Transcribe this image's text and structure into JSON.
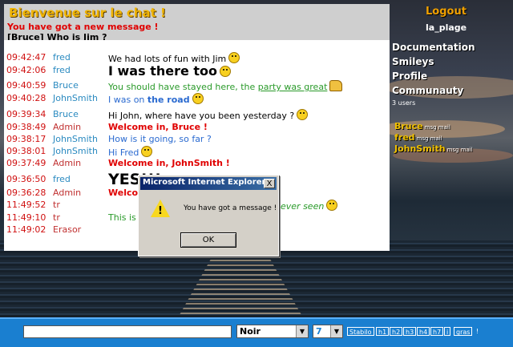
{
  "header": {
    "title": "Bienvenue sur le chat !",
    "new_message": "You have got a new message !",
    "private_line": "[Bruce] Who is Jim ?"
  },
  "chat": [
    {
      "time": "09:42:47",
      "nick": "fred",
      "nick_class": "c-fred",
      "msg": "We had lots of fun with Jim",
      "style": "normal",
      "icon": "smiley"
    },
    {
      "time": "09:42:06",
      "nick": "fred",
      "nick_class": "c-fred",
      "msg": "I was there too",
      "style": "big",
      "icon": "smiley"
    },
    {
      "time": "09:40:59",
      "nick": "Bruce",
      "nick_class": "c-bruce",
      "msg": "You should have stayed here, the ",
      "link": "party was great",
      "style": "green",
      "icon": "thumb"
    },
    {
      "time": "09:40:28",
      "nick": "JohnSmith",
      "nick_class": "c-john",
      "msg": "I was on ",
      "bold": "the road",
      "style": "blue",
      "icon": "smiley"
    },
    {
      "time": "09:39:34",
      "nick": "Bruce",
      "nick_class": "c-bruce",
      "msg": "Hi John, where have you been yesterday ?",
      "style": "normal",
      "icon": "smiley"
    },
    {
      "time": "09:38:49",
      "nick": "Admin",
      "nick_class": "c-admin",
      "msg": "Welcome in, Bruce !",
      "style": "red"
    },
    {
      "time": "09:38:17",
      "nick": "JohnSmith",
      "nick_class": "c-john",
      "msg": "How is it going, so far ?",
      "style": "blue"
    },
    {
      "time": "09:38:01",
      "nick": "JohnSmith",
      "nick_class": "c-john",
      "msg": "Hi Fred",
      "style": "blue",
      "icon": "smiley"
    },
    {
      "time": "09:37:49",
      "nick": "Admin",
      "nick_class": "c-admin",
      "msg": "Welcome in, JohnSmith !",
      "style": "red"
    },
    {
      "time": "09:36:50",
      "nick": "fred",
      "nick_class": "c-fred",
      "msg": "YES!!!",
      "style": "huge"
    },
    {
      "time": "09:36:28",
      "nick": "Admin",
      "nick_class": "c-admin",
      "msg": "Welco",
      "style": "red"
    },
    {
      "time": "11:49:52",
      "nick": "tr",
      "nick_class": "c-tr",
      "msg": "",
      "style": "normal",
      "tail": "ever seen",
      "icon": "smiley"
    },
    {
      "time": "11:49:10",
      "nick": "tr",
      "nick_class": "c-tr",
      "msg": "This is",
      "style": "green"
    },
    {
      "time": "11:49:02",
      "nick": "Erasor",
      "nick_class": "c-erasor",
      "msg": "",
      "style": "normal"
    }
  ],
  "side": {
    "logout": "Logout",
    "room": "la_plage",
    "menu": [
      "Documentation",
      "Smileys",
      "Profile",
      "Communauty"
    ],
    "users_count": "3 users",
    "users": [
      {
        "name": "Bruce",
        "tag": "msg mail"
      },
      {
        "name": "fred",
        "tag": "msg mail"
      },
      {
        "name": "JohnSmith",
        "tag": "msg mail"
      }
    ]
  },
  "bottom": {
    "input_value": "",
    "color_select": "Noir",
    "size_select": "7",
    "format_buttons": [
      "Stabilo",
      "h1",
      "h2",
      "h3",
      "h4",
      "h7",
      "i",
      "gras",
      "!"
    ]
  },
  "dialog": {
    "title": "Microsoft Internet Explorer",
    "message": "You have got a message !",
    "ok": "OK",
    "close": "X"
  },
  "colors": {
    "accent": "#f0b400",
    "bar": "#1a7fd0",
    "red": "#e00000"
  }
}
